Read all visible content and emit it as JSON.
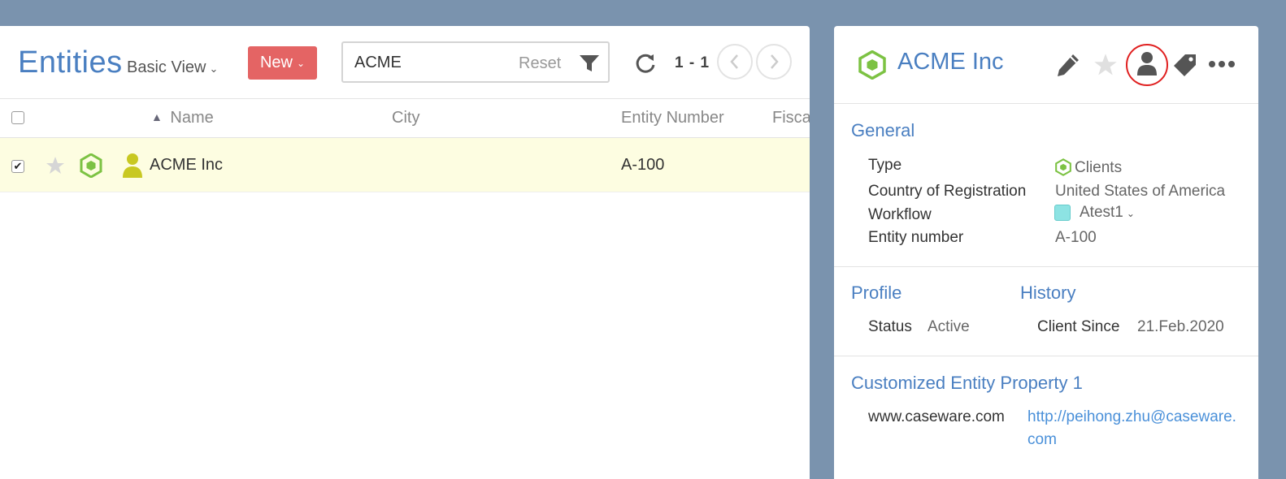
{
  "list": {
    "title": "Entities",
    "view_label": "Basic View",
    "new_label": "New",
    "search_value": "ACME",
    "reset_label": "Reset",
    "pager_range": "1 - 1",
    "columns": [
      "Name",
      "City",
      "Entity Number",
      "Fisca"
    ],
    "rows": [
      {
        "name": "ACME Inc",
        "city": "",
        "entity_number": "A-100",
        "selected": true,
        "starred": false
      }
    ]
  },
  "detail": {
    "title": "ACME Inc",
    "general": {
      "heading": "General",
      "fields": [
        {
          "label": "Type",
          "value": "Clients"
        },
        {
          "label": "Country of Registration",
          "value": "United States of America"
        },
        {
          "label": "Workflow",
          "value": "Atest1"
        },
        {
          "label": "Entity number",
          "value": "A-100"
        }
      ]
    },
    "profile": {
      "heading": "Profile",
      "status_label": "Status",
      "status_value": "Active"
    },
    "history": {
      "heading": "History",
      "client_since_label": "Client Since",
      "client_since_value": "21.Feb.2020"
    },
    "custom": {
      "heading": "Customized Entity Property 1",
      "label": "www.caseware.com",
      "value": "http://peihong.zhu@caseware.com"
    }
  },
  "colors": {
    "accent_blue": "#4a7fc1",
    "new_button": "#e46464",
    "entity_green": "#7cc243",
    "client_yellow": "#c8c821",
    "selected_row": "#fdfde1",
    "workflow_swatch": "#8de3e3",
    "highlight_circle": "#e02020"
  },
  "icons": [
    "filter-icon",
    "refresh-icon",
    "chevron-left-icon",
    "chevron-right-icon",
    "star-icon",
    "hexagon-icon",
    "person-icon",
    "pencil-icon",
    "tag-icon",
    "more-icon"
  ]
}
